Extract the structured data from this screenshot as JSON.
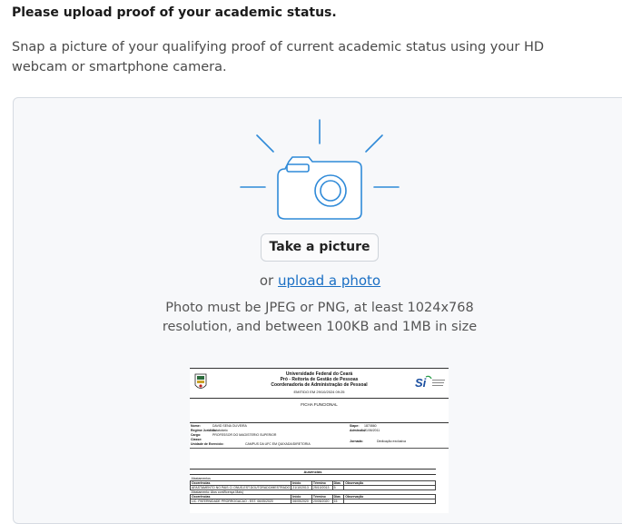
{
  "heading": "Please upload proof of your academic status.",
  "instructions": "Snap a picture of your qualifying proof of current academic status using your HD webcam or smartphone camera.",
  "capture": {
    "take_picture_label": "Take a picture",
    "or_text": "or",
    "upload_link_label": "upload a photo",
    "requirements": "Photo must be JPEG or PNG, at least 1024x768 resolution, and between 100KB and 1MB in size"
  },
  "document_preview": {
    "header_lines": [
      "Universidade Federal do Ceará",
      "Pró - Reitoria de Gestão de Pessoas",
      "Coordenadoria de Administração de Pessoal"
    ],
    "emitted": "EMITIDO EM 29/10/2024 09:25",
    "form_title": "FICHA FUNCIONAL",
    "left_fields": [
      {
        "label": "Nome:",
        "value": "DAVID SENA OLIVEIRA"
      },
      {
        "label": "Regime Jurídico:",
        "value": "Estatutário"
      },
      {
        "label": "Cargo:",
        "value": "PROFESSOR DO MAGISTERIO SUPERIOR"
      },
      {
        "label": "Classe:",
        "value": ""
      },
      {
        "label": "Unidade de Exercício:",
        "value": "CAMPUS DA UFC EM QUIXADA/DIRETORIA"
      }
    ],
    "right_fields": [
      {
        "label": "Siape:",
        "value": "1870860"
      },
      {
        "label": "Admissão:",
        "value": "21/06/2011"
      },
      {
        "label": "Jornada:",
        "value": "Dedicação exclusiva"
      }
    ],
    "section_title": "Ausências",
    "subsection_1": "Afastamentos",
    "columns": [
      "Ocorrências",
      "Início",
      "Término",
      "Dias",
      "Observação"
    ],
    "rows_1": [
      [
        "AFASTAMENTO NO PAIS C/ ONUS-EST.DOUTORADO/MESTRADO",
        "21/10/2013",
        "25/10/2013",
        "5",
        ""
      ]
    ],
    "subsection_2": "Afastamento: Atos conf/licença Mais)",
    "rows_2": [
      [
        "LIC. PATERNIDADE PRORROGACAO - EST. 06/05/2020",
        "06/05/2020",
        "20/05/2020",
        "15",
        ""
      ]
    ]
  }
}
